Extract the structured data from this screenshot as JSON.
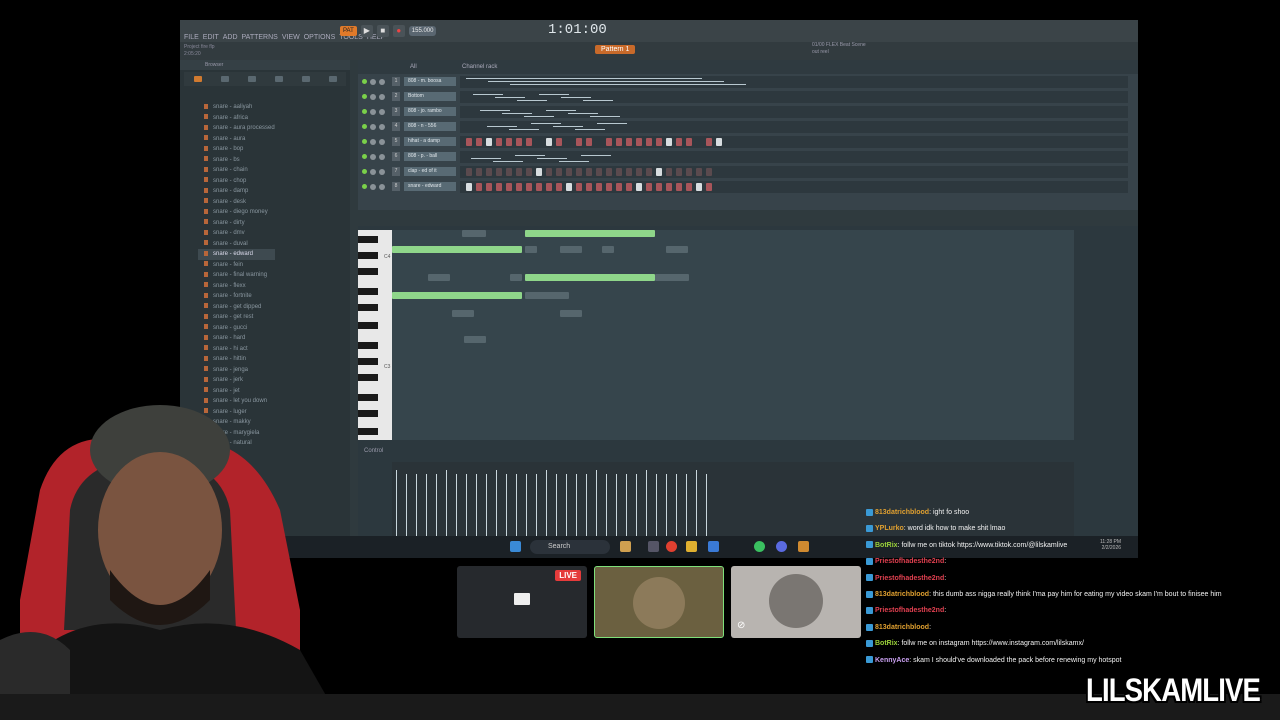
{
  "menu": [
    "FILE",
    "EDIT",
    "ADD",
    "PATTERNS",
    "VIEW",
    "OPTIONS",
    "TOOLS",
    "HELP"
  ],
  "transport": {
    "pattern_song": "PAT",
    "tempo": "155.000",
    "time": "1:01:00",
    "time_unit": ""
  },
  "project": {
    "name": "Project fire flp",
    "time": "2:05:20",
    "pattern_label": "Pattern 1",
    "hint": "01/00 FLEX Beat Scene",
    "hint2": "out reel"
  },
  "browser": {
    "title": "Browser",
    "items": [
      "snare - aaliyah",
      "snare - africa",
      "snare - aura processed",
      "snare - aura",
      "snare - bop",
      "snare - bs",
      "snare - chain",
      "snare - chop",
      "snare - damp",
      "snare - desk",
      "snare - diego money",
      "snare - dirty",
      "snare - dmv",
      "snare - duval",
      "snare - edward",
      "snare - fein",
      "snare - final warning",
      "snare - flexx",
      "snare - fortnite",
      "snare - get dipped",
      "snare - get rest",
      "snare - gucci",
      "snare - hard",
      "snare - hi act",
      "snare - hittin",
      "snare - jenga",
      "snare - jerk",
      "snare - jet",
      "snare - let you down",
      "snare - luger",
      "snare - makky",
      "snare - marygiela",
      "snare - natural",
      "snare - ..."
    ],
    "selected_index": 14
  },
  "rack": {
    "title": "Channel rack",
    "filter": "All",
    "channels": [
      {
        "num": "1",
        "name": "808 - m. boosa"
      },
      {
        "num": "2",
        "name": "Bottom"
      },
      {
        "num": "3",
        "name": "808 - jo. rambo"
      },
      {
        "num": "4",
        "name": "808 - n - 556"
      },
      {
        "num": "5",
        "name": "hihat - a damp"
      },
      {
        "num": "6",
        "name": "808 - p. - ball"
      },
      {
        "num": "7",
        "name": "clap - ed of it"
      },
      {
        "num": "8",
        "name": "snare - edward"
      }
    ]
  },
  "roll": {
    "control_label": "Control",
    "key_labels": [
      "C4",
      "C3"
    ]
  },
  "taskbar": {
    "search": "Search",
    "time": "11:28 PM",
    "date": "2/2/2026"
  },
  "thumbs": {
    "live": "LIVE"
  },
  "chat": [
    {
      "user": "813datrichblood",
      "color": "#e0a030",
      "text": ": ight fo shoo"
    },
    {
      "user": "YPLurko",
      "color": "#e0a030",
      "text": ": word idk how to make shit lmao"
    },
    {
      "user": "BotRix",
      "color": "#9bd23a",
      "text": ": follw me on tiktok https://www.tiktok.com/@lilskamlive"
    },
    {
      "user": "Priestofhadesthe2nd",
      "color": "#e04050",
      "text": ":"
    },
    {
      "user": "Priestofhadesthe2nd",
      "color": "#e04050",
      "text": ":"
    },
    {
      "user": "813datrichblood",
      "color": "#e0a030",
      "text": ": this dumb ass nigga really think I'ma pay him for eating my video skam I'm bout to finisee him"
    },
    {
      "user": "Priestofhadesthe2nd",
      "color": "#e04050",
      "text": ":"
    },
    {
      "user": "813datrichblood",
      "color": "#e0a030",
      "text": ":"
    },
    {
      "user": "BotRix",
      "color": "#9bd23a",
      "text": ": follw me on instagram https://www.instagram.com/lilskamx/"
    },
    {
      "user": "KennyAce",
      "color": "#c9a0f0",
      "text": ": skam I should've downloaded the pack before renewing my hotspot"
    }
  ],
  "watermark": "LILSKAMLIVE",
  "accent": "#d07a30"
}
